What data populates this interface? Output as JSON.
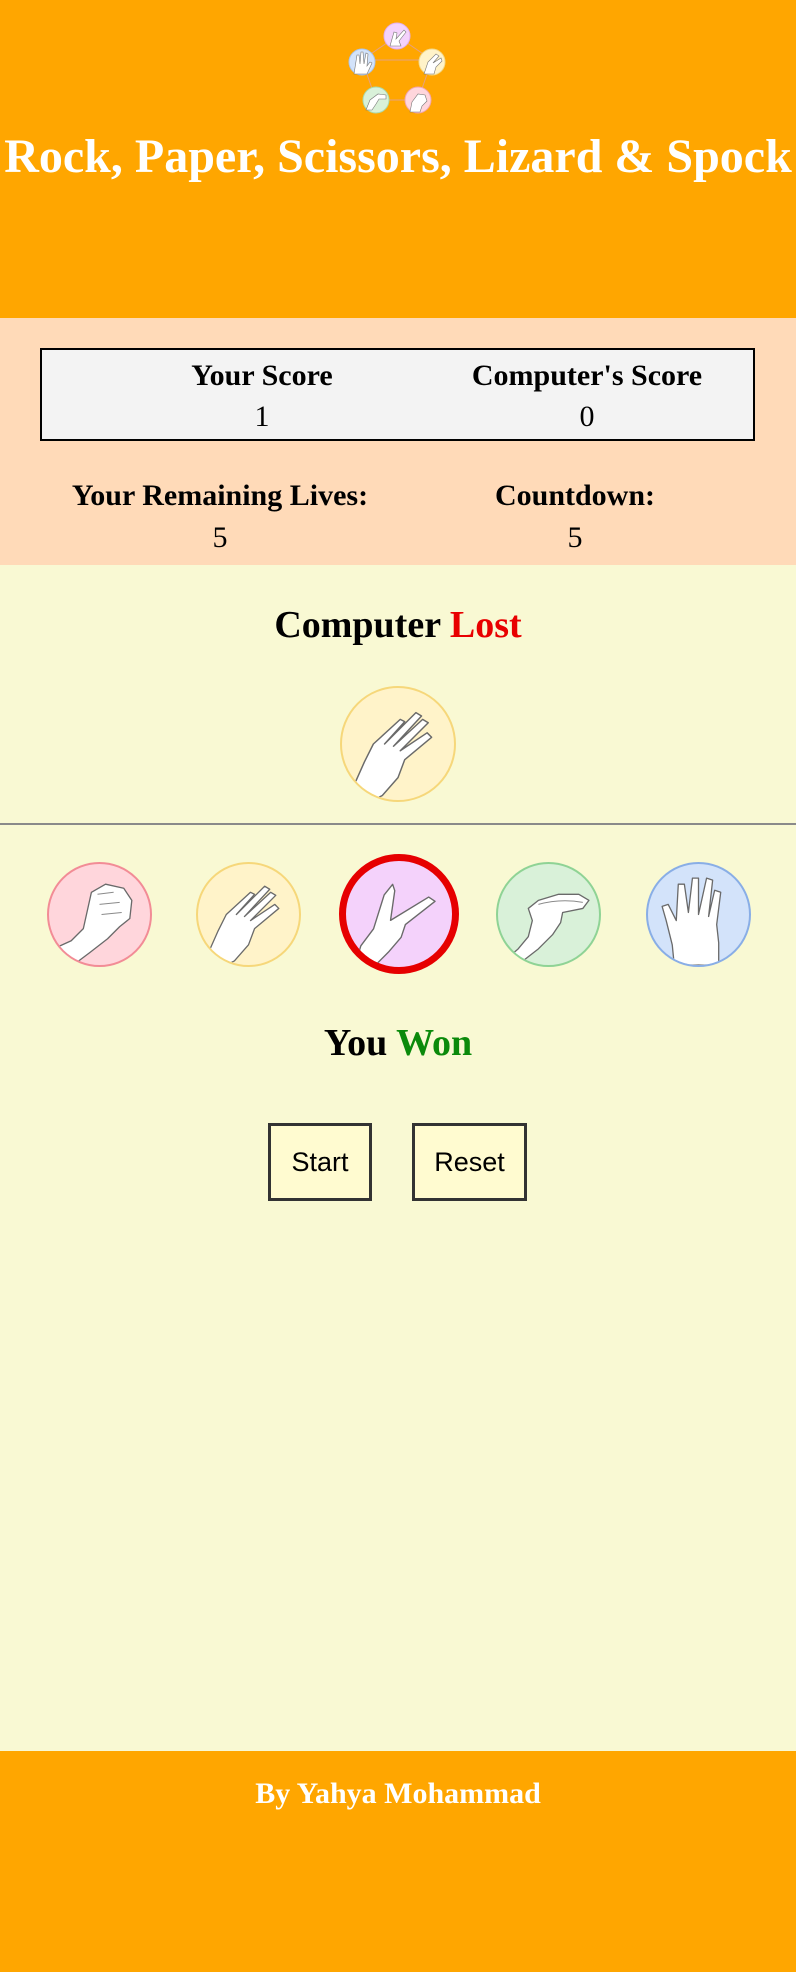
{
  "header": {
    "title": "Rock, Paper, Scissors, Lizard & Spock",
    "logo_icon": "rpsls-logo-icon"
  },
  "scoreboard": {
    "player_label": "Your Score",
    "player_value": "1",
    "computer_label": "Computer's Score",
    "computer_value": "0"
  },
  "status": {
    "lives_label": "Your Remaining Lives:",
    "lives_value": "5",
    "countdown_label": "Countdown:",
    "countdown_value": "5"
  },
  "computer_result": {
    "subject": "Computer",
    "outcome": "Lost",
    "outcome_color": "#e80000"
  },
  "computer_choice": {
    "name": "paper",
    "icon": "paper-hand-icon"
  },
  "choices": [
    {
      "name": "rock",
      "icon": "rock-hand-icon",
      "bg": "#ffd6dc",
      "border": "#f28c96",
      "selected": false
    },
    {
      "name": "paper",
      "icon": "paper-hand-icon",
      "bg": "#fff3c9",
      "border": "#f6d77a",
      "selected": false
    },
    {
      "name": "scissors",
      "icon": "scissors-hand-icon",
      "bg": "#f4d2fb",
      "border": "#e60000",
      "selected": true
    },
    {
      "name": "lizard",
      "icon": "lizard-hand-icon",
      "bg": "#d9f1d9",
      "border": "#8fd395",
      "selected": false
    },
    {
      "name": "spock",
      "icon": "spock-hand-icon",
      "bg": "#d3e3fa",
      "border": "#89aee6",
      "selected": false
    }
  ],
  "player_result": {
    "subject": "You",
    "outcome": "Won",
    "outcome_color": "#0b8a0b"
  },
  "buttons": {
    "start_label": "Start",
    "reset_label": "Reset"
  },
  "footer": {
    "credit": "By Yahya Mohammad"
  },
  "colors": {
    "brand_orange": "#ffa600",
    "score_zone": "#ffdab8",
    "play_area": "#f9f9d3"
  }
}
